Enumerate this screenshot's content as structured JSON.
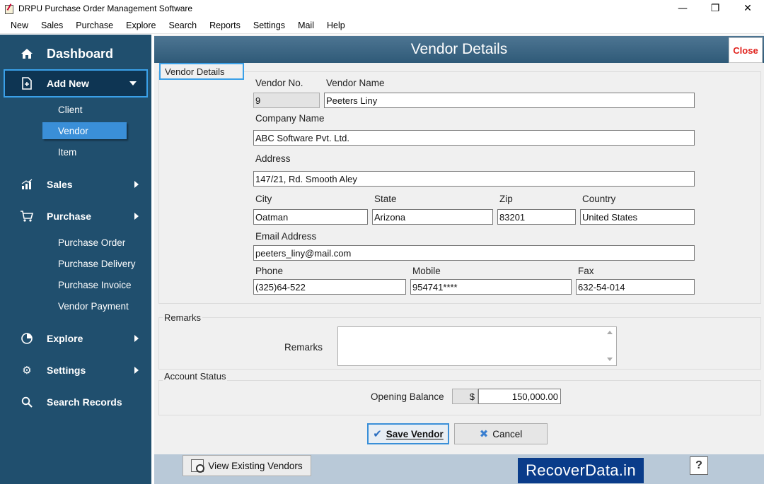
{
  "window": {
    "title": "DRPU Purchase Order Management Software",
    "minimize": "—",
    "maximize": "❐",
    "close": "✕"
  },
  "menu": [
    "New",
    "Sales",
    "Purchase",
    "Explore",
    "Search",
    "Reports",
    "Settings",
    "Mail",
    "Help"
  ],
  "sidebar": {
    "dashboard": "Dashboard",
    "add_new": "Add New",
    "add_new_items": [
      "Client",
      "Vendor",
      "Item"
    ],
    "sales": "Sales",
    "purchase": "Purchase",
    "purchase_items": [
      "Purchase Order",
      "Purchase Delivery",
      "Purchase Invoice",
      "Vendor Payment"
    ],
    "explore": "Explore",
    "settings": "Settings",
    "search_records": "Search Records"
  },
  "main": {
    "title": "Vendor Details",
    "close_label": "Close",
    "vendor_details_group": "Vendor Details",
    "fields": {
      "vendor_no_label": "Vendor No.",
      "vendor_no": "9",
      "vendor_name_label": "Vendor Name",
      "vendor_name": "Peeters Liny",
      "company_name_label": "Company Name",
      "company_name": "ABC Software Pvt. Ltd.",
      "address_label": "Address",
      "address": "147/21, Rd. Smooth Aley",
      "city_label": "City",
      "city": "Oatman",
      "state_label": "State",
      "state": "Arizona",
      "zip_label": "Zip",
      "zip": "83201",
      "country_label": "Country",
      "country": "United States",
      "email_label": "Email Address",
      "email": "peeters_liny@mail.com",
      "phone_label": "Phone",
      "phone": "(325)64-522",
      "mobile_label": "Mobile",
      "mobile": "954741****",
      "fax_label": "Fax",
      "fax": "632-54-014"
    },
    "remarks_group": "Remarks",
    "remarks_label": "Remarks",
    "remarks_value": "",
    "account_group": "Account Status",
    "opening_balance_label": "Opening Balance",
    "currency_symbol": "$",
    "opening_balance": "150,000.00",
    "save_button": "Save Vendor",
    "cancel_button": "Cancel",
    "view_vendors_button": "View Existing Vendors",
    "watermark": "RecoverData.in",
    "help_symbol": "?"
  }
}
